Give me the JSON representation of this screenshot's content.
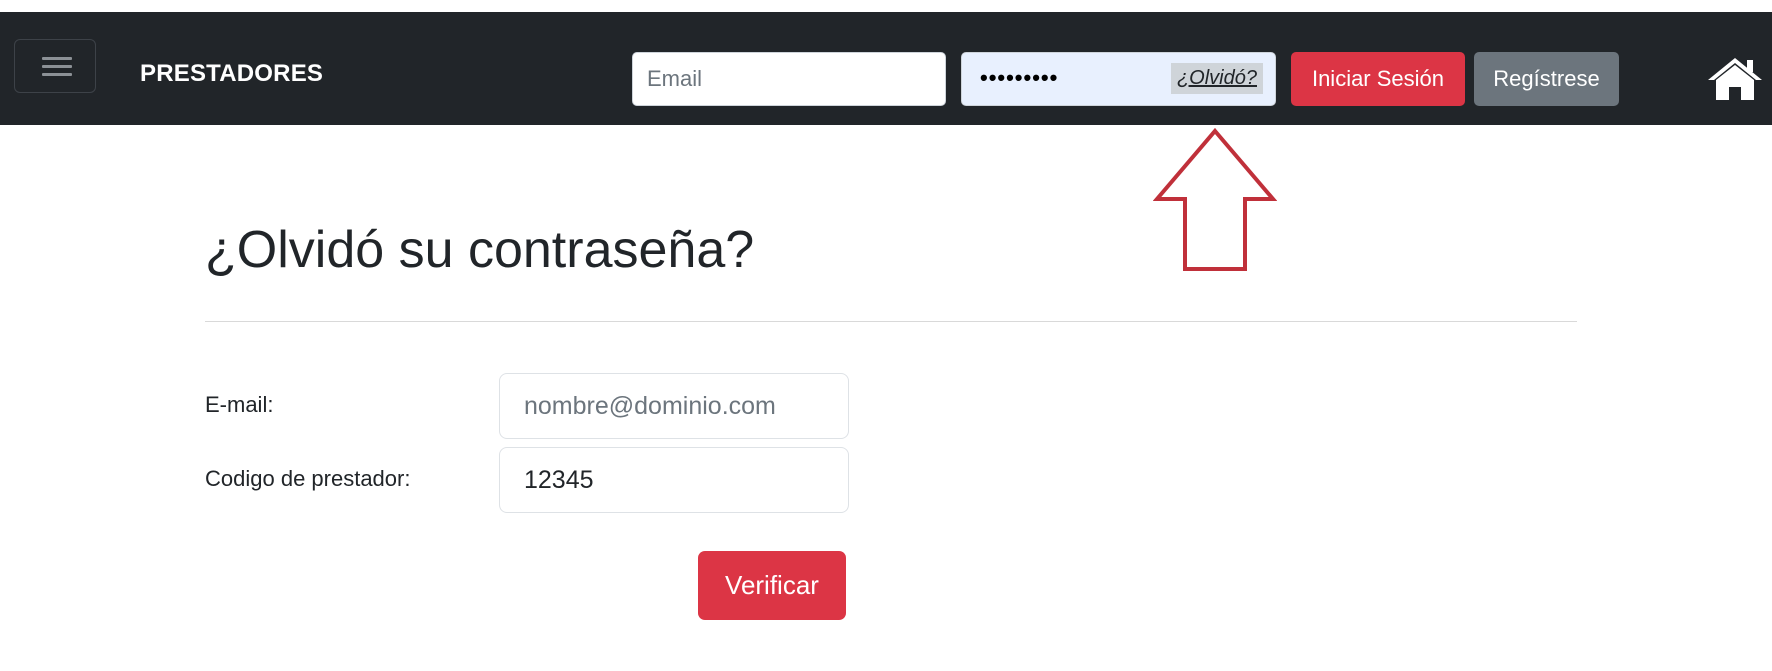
{
  "navbar": {
    "brand": "PRESTADORES",
    "email_placeholder": "Email",
    "password_masked": "•••••••••",
    "forgot_link": "¿Olvidó?",
    "login_button": "Iniciar Sesión",
    "register_button": "Regístrese"
  },
  "page": {
    "title": "¿Olvidó su contraseña?"
  },
  "form": {
    "email_label": "E-mail:",
    "email_placeholder": "nombre@dominio.com",
    "code_label": "Codigo de prestador:",
    "code_value": "12345",
    "verify_button": "Verificar"
  },
  "colors": {
    "navbar_bg": "#212529",
    "danger": "#dc3545",
    "secondary": "#6c757d",
    "annotation_arrow": "#c0303a"
  },
  "icons": {
    "menu": "hamburger-icon",
    "home": "home-icon",
    "annotation": "up-arrow-annotation"
  }
}
